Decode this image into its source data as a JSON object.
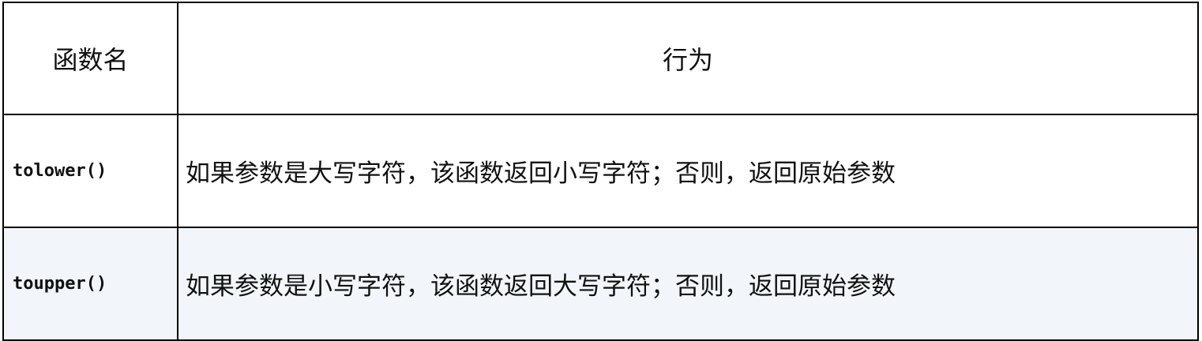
{
  "table": {
    "headers": [
      "函数名",
      "行为"
    ],
    "rows": [
      {
        "function": "tolower()",
        "behavior": "如果参数是大写字符，该函数返回小写字符；否则，返回原始参数"
      },
      {
        "function": "toupper()",
        "behavior": "如果参数是小写字符，该函数返回大写字符；否则，返回原始参数"
      }
    ]
  },
  "colors": {
    "border": "#000000",
    "alt_row_background": "#f2f5f9",
    "text": "#111111"
  }
}
